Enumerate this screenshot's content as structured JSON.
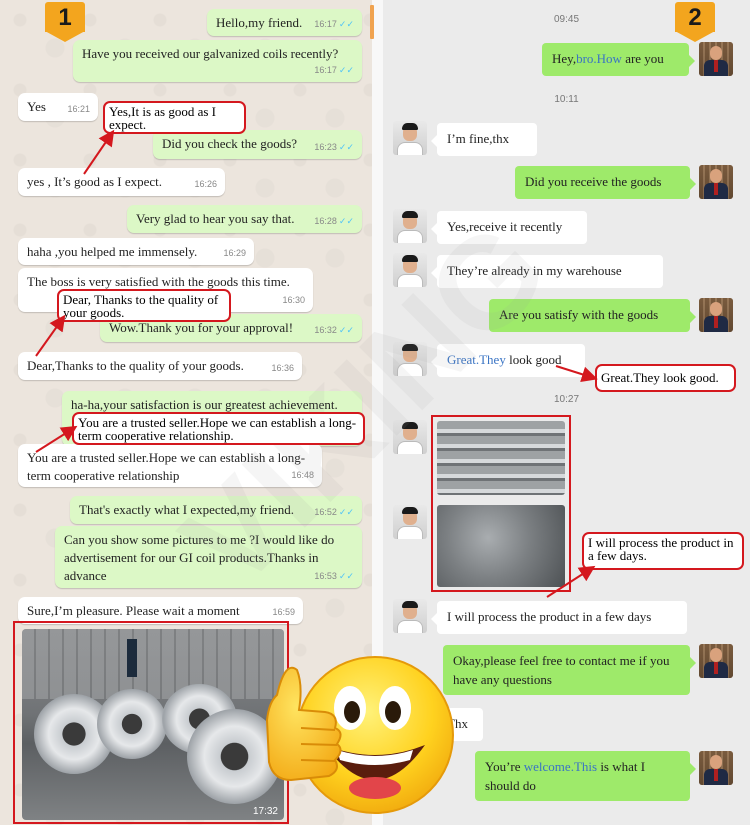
{
  "badges": {
    "left": "1",
    "right": "2"
  },
  "watermark": "VIKING",
  "left_chat": {
    "messages": [
      {
        "text": "Hello,my friend.",
        "time": "16:17"
      },
      {
        "text": "Have you received our galvanized coils recently?",
        "time": "16:17"
      },
      {
        "text": "Yes",
        "time": "16:21"
      },
      {
        "text": "Did you check the goods?",
        "time": "16:23"
      },
      {
        "text": "yes , It’s good as I expect.",
        "time": "16:26"
      },
      {
        "text": "Very glad to hear you say that.",
        "time": "16:28"
      },
      {
        "text": "haha ,you helped me immensely.",
        "time": "16:29"
      },
      {
        "text": "The boss is very satisfied with the goods this time.",
        "time": "16:30"
      },
      {
        "text": "Wow.Thank you for your approval!",
        "time": "16:32"
      },
      {
        "text": "Dear,Thanks to the quality of your goods.",
        "time": "16:36"
      },
      {
        "text": "ha-ha,your satisfaction is our greatest achievement.",
        "time": ""
      },
      {
        "text": "You are a trusted seller.Hope we can establish a long-term cooperative relationship",
        "time": "16:48"
      },
      {
        "text": "That's exactly what I expected,my friend.",
        "time": "16:52"
      },
      {
        "text": "Can you show some pictures to me ?I would like do advertisement for our GI coil products.Thanks in advance",
        "time": "16:53"
      },
      {
        "text": "Sure,I’m pleasure. Please wait a moment",
        "time": "16:59"
      }
    ],
    "photo_time": "17:32"
  },
  "callouts": {
    "c1": "Yes,It is as good as I expect.",
    "c2": "Dear, Thanks to the quality of your goods.",
    "c3": "You are a trusted seller.Hope we can establish a long-term cooperative relationship.",
    "c4": "Great.They look good.",
    "c5": "I will process the product in a few days."
  },
  "right_chat": {
    "times": [
      "09:45",
      "10:11",
      "10:27"
    ],
    "m1": {
      "a": "Hey,",
      "b": "bro.How",
      "c": " are you"
    },
    "m2": "I’m fine,thx",
    "m3": "Did you receive the goods",
    "m4": "Yes,receive it recently",
    "m5": "They’re already in my warehouse",
    "m6": "Are you satisfy with the goods",
    "m7": {
      "a": "Great.They",
      "b": " look good"
    },
    "m8": "I will process the product in a few days",
    "m9": "Okay,please feel free to contact me if you have any questions",
    "m10": "Thx",
    "m11": {
      "a": "You’re ",
      "b": "welcome.This",
      "c": " is what I should do"
    }
  },
  "colors": {
    "accent_red": "#d4181e",
    "whatsapp_out": "#dcf8c6",
    "wechat_out": "#9eea6a",
    "badge": "#f3a51e"
  }
}
